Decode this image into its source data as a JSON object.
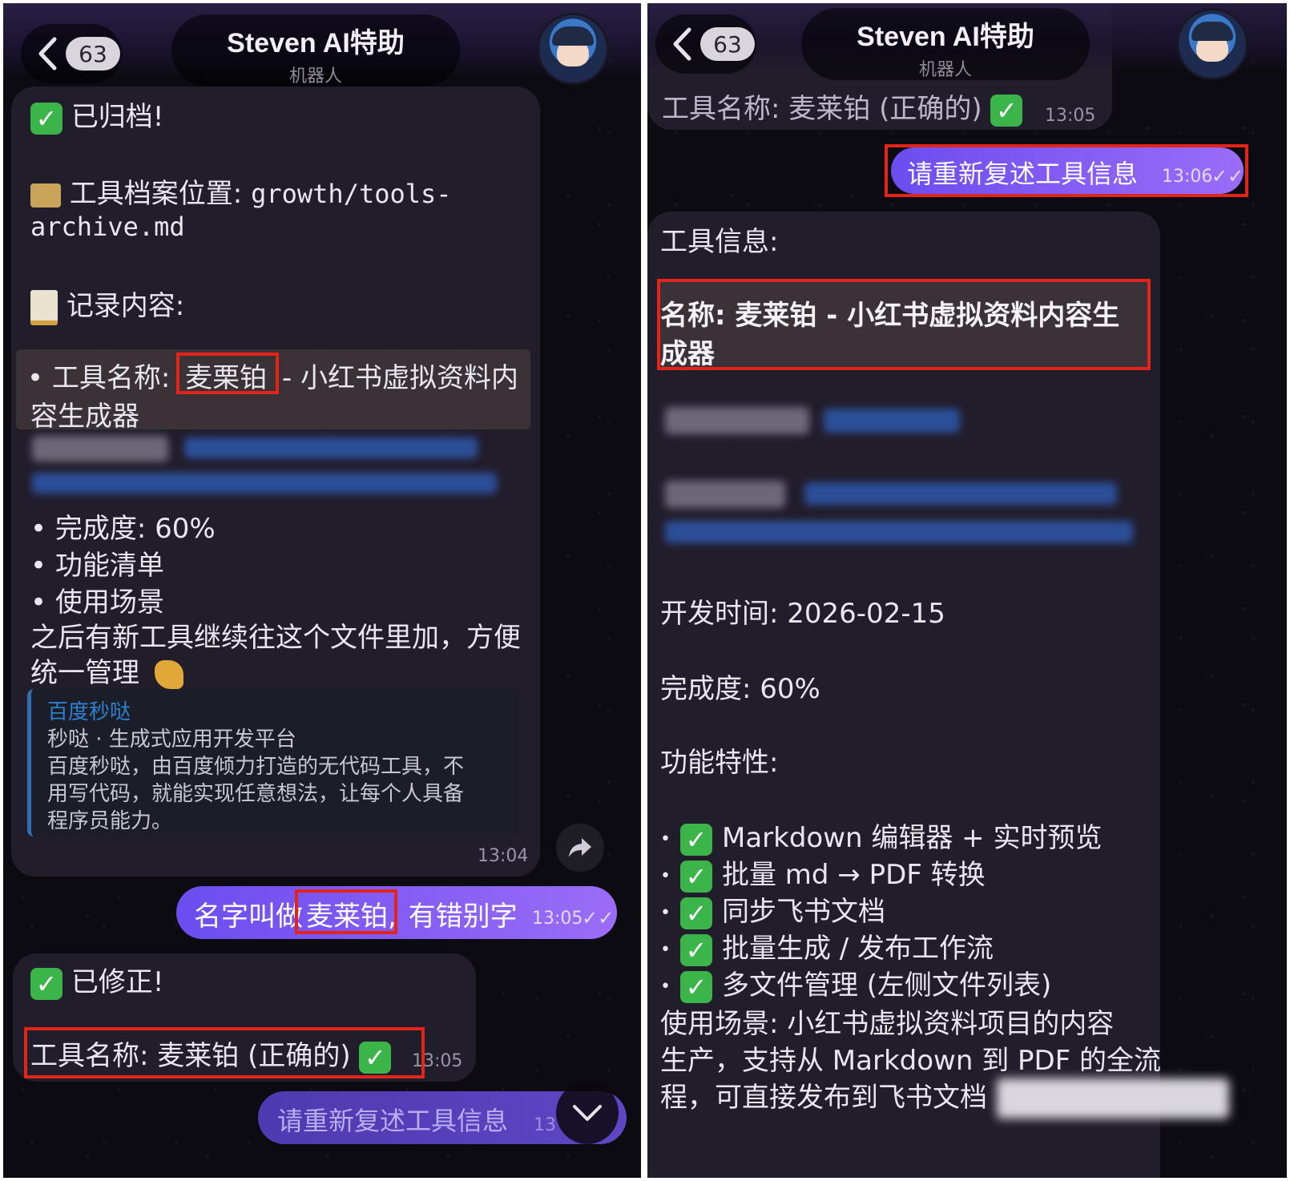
{
  "header": {
    "back_count": "63",
    "title": "Steven AI特助",
    "subtitle": "机器人"
  },
  "left": {
    "archive_bubble": {
      "status": "已归档!",
      "location_label": "工具档案位置:",
      "location_path_1": "growth/tools-",
      "location_path_2": "archive.md",
      "record_label": "记录内容:",
      "tool_name_prefix": "• 工具名称:",
      "tool_name_highlight": "麦栗铂",
      "tool_name_rest": "- 小红书虚拟资料内",
      "tool_name_cont": "容生成器",
      "progress": "• 完成度:  60%",
      "features": "• 功能清单",
      "scenarios": "• 使用场景",
      "note_1": "之后有新工具继续往这个文件里加，方便",
      "note_2": "统一管理",
      "time": "13:04"
    },
    "quote": {
      "source": "百度秒哒",
      "title": "秒哒 · 生成式应用开发平台",
      "line_1": "百度秒哒，由百度倾力打造的无代码工具，不",
      "line_2": "用写代码，就能实现任意想法，让每个人具备",
      "line_3": "程序员能力。"
    },
    "user_msg": {
      "prefix": "名字叫做",
      "highlight": "麦莱铂,",
      "suffix": "有错别字",
      "time": "13:05"
    },
    "fix_bubble": {
      "status": "已修正!",
      "tool_line": "工具名称:  麦莱铂 (正确的)",
      "time": "13:05"
    },
    "pending_msg": {
      "text": "请重新复述工具信息",
      "time": "13:06"
    }
  },
  "right": {
    "prev_line": "工具名称:  麦莱铂 (正确的)",
    "prev_time": "13:05",
    "user_msg": {
      "text": "请重新复述工具信息",
      "time": "13:06"
    },
    "info_bubble": {
      "heading": "工具信息:",
      "name_line_1": "名称:   麦莱铂 - 小红书虚拟资料内容生",
      "name_line_2": "成器",
      "dev_time": "开发时间:   2026-02-15",
      "progress": "完成度:   60%",
      "features_heading": "功能特性:",
      "features": [
        "Markdown 编辑器 + 实时预览",
        "批量 md → PDF 转换",
        "同步飞书文档",
        "批量生成 / 发布工作流",
        "多文件管理 (左侧文件列表)"
      ],
      "scenario_1": "使用场景:   小红书虚拟资料项目的内容",
      "scenario_2": "生产，支持从 Markdown 到 PDF 的全流",
      "scenario_3": "程，可直接发布到飞书文档"
    }
  },
  "colors": {
    "accent": "#7b5cf5",
    "highlight_box": "#e3241b",
    "check_green": "#3bb54a",
    "link_blue": "#2f7fd0"
  }
}
